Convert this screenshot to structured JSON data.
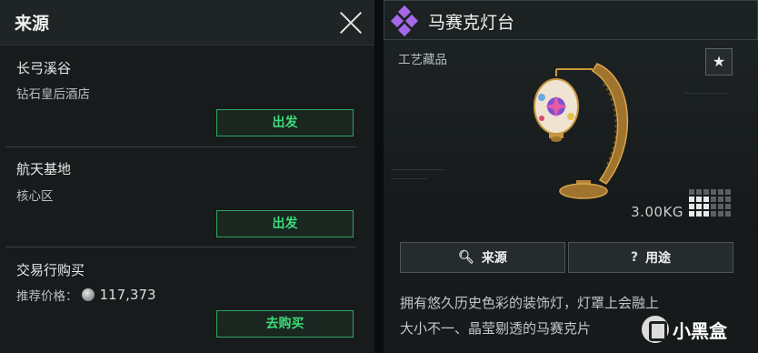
{
  "source_panel": {
    "title": "来源",
    "sources": [
      {
        "name": "长弓溪谷",
        "sub": "钻石皇后酒店",
        "button": "出发"
      },
      {
        "name": "航天基地",
        "sub": "核心区",
        "button": "出发"
      },
      {
        "name": "交易行购买",
        "price_label": "推荐价格：",
        "price": "117,373",
        "button": "去购买"
      }
    ]
  },
  "item_panel": {
    "title": "马赛克灯台",
    "rarity_color": "#a468e8",
    "category": "工艺藏品",
    "weight": "3.00KG",
    "size_grid": {
      "cols": 6,
      "rows": 4,
      "occupied_cols": 3,
      "occupied_rows": 3
    },
    "actions": [
      {
        "icon": "search-icon",
        "label": "来源"
      },
      {
        "icon": "question-icon",
        "label": "用途"
      }
    ],
    "description_lines": [
      "拥有悠久历史色彩的装饰灯，灯罩上会融上",
      "大小不一、晶莹剔透的马赛克片"
    ]
  },
  "watermark": {
    "text": "小黑盒"
  },
  "colors": {
    "accent_green": "#3ddc7a",
    "panel_bg": "#171b1c"
  }
}
